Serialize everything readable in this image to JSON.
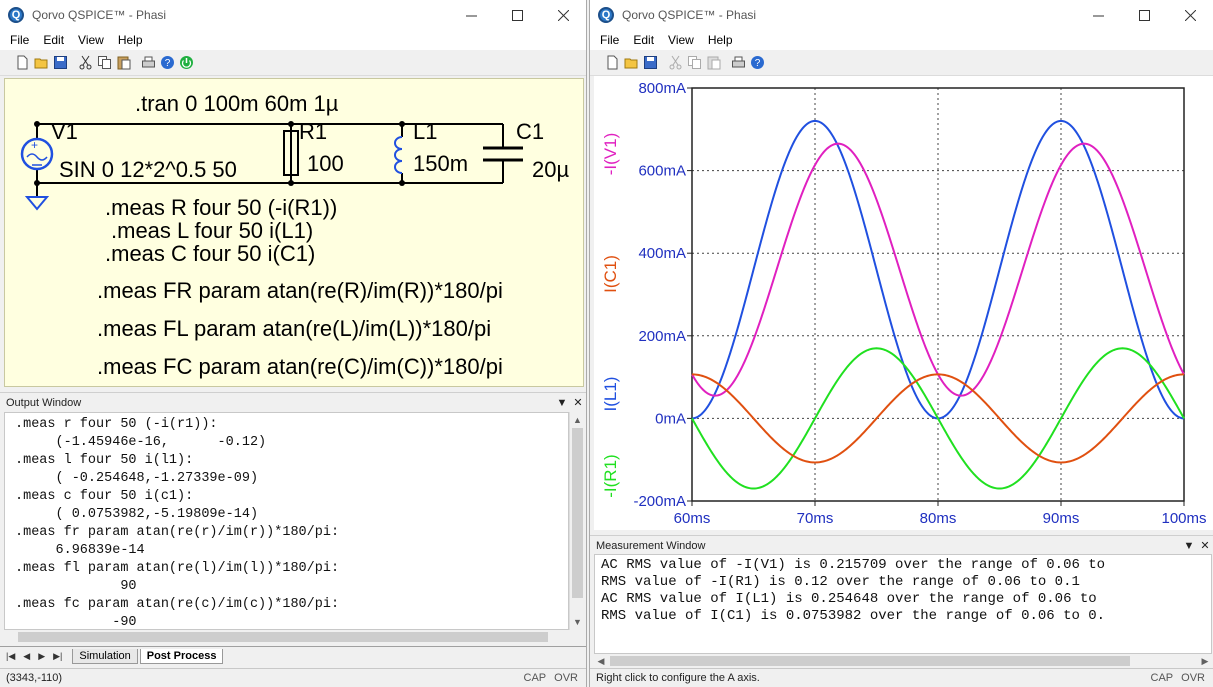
{
  "left_window": {
    "title": "Qorvo QSPICE™ - Phasi",
    "menu": [
      "File",
      "Edit",
      "View",
      "Help"
    ],
    "schematic": {
      "directive_tran": ".tran 0 100m 60m 1µ",
      "v1_name": "V1",
      "v1_value": "SIN 0 12*2^0.5 50",
      "r1_name": "R1",
      "r1_value": "100",
      "l1_name": "L1",
      "l1_value": "150m",
      "c1_name": "C1",
      "c1_value": "20µ",
      "meas_lines": [
        ".meas R four 50 (-i(R1))",
        ".meas L four 50 i(L1)",
        ".meas C four 50 i(C1)",
        ".meas FR param  atan(re(R)/im(R))*180/pi",
        ".meas FL param  atan(re(L)/im(L))*180/pi",
        ".meas FC param  atan(re(C)/im(C))*180/pi"
      ]
    },
    "output_window": {
      "title": "Output Window",
      "lines": [
        ".meas r four 50 (-i(r1)):",
        "     (-1.45946e-16,      -0.12)",
        ".meas l four 50 i(l1):",
        "     ( -0.254648,-1.27339e-09)",
        ".meas c four 50 i(c1):",
        "     ( 0.0753982,-5.19809e-14)",
        ".meas fr param atan(re(r)/im(r))*180/pi:",
        "     6.96839e-14",
        ".meas fl param atan(re(l)/im(l))*180/pi:",
        "             90",
        ".meas fc param atan(re(c)/im(c))*180/pi:",
        "            -90"
      ]
    },
    "tabs": [
      "Simulation",
      "Post Process"
    ],
    "status": {
      "coords": "(3343,-110)",
      "cap": "CAP",
      "ovr": "OVR"
    }
  },
  "right_window": {
    "title": "Qorvo QSPICE™ - Phasi",
    "menu": [
      "File",
      "Edit",
      "View",
      "Help"
    ],
    "measurement_window": {
      "title": "Measurement Window",
      "lines": [
        "AC RMS value of -I(V1) is 0.215709 over the range of 0.06 to",
        "RMS value of -I(R1) is 0.12 over the range of 0.06 to 0.1",
        "AC RMS value of I(L1) is 0.254648 over the range of 0.06 to",
        "RMS value of I(C1) is 0.0753982 over the range of 0.06 to 0."
      ]
    },
    "status": {
      "message": "Right click to configure the A axis.",
      "cap": "CAP",
      "ovr": "OVR"
    }
  },
  "chart_data": {
    "type": "line",
    "xlim": [
      0.06,
      0.1
    ],
    "ylim": [
      -0.2,
      0.8
    ],
    "x_ticks": [
      0.06,
      0.07,
      0.08,
      0.09,
      0.1
    ],
    "x_tick_labels": [
      "60ms",
      "70ms",
      "80ms",
      "90ms",
      "100ms"
    ],
    "y_ticks": [
      -0.2,
      0,
      0.2,
      0.4,
      0.6,
      0.8
    ],
    "y_tick_labels": [
      "-200mA",
      "0mA",
      "200mA",
      "400mA",
      "600mA",
      "800mA"
    ],
    "grid": true,
    "legend_placement": "left-vertical",
    "frequency_hz": 50,
    "series": [
      {
        "name": "-I(V1)",
        "color": "#e020c0",
        "kind": "abs_sum",
        "r_amp": 0.16971,
        "l_amp": 0.36013,
        "c_amp": 0.10663,
        "mean": 0.36013
      },
      {
        "name": "I(C1)",
        "color": "#e05010",
        "kind": "cos",
        "amp": 0.10663,
        "mean": 0
      },
      {
        "name": "I(L1)",
        "color": "#2050e0",
        "kind": "one_minus_cos",
        "amp": 0.36013,
        "mean": 0.36013
      },
      {
        "name": "-I(R1)",
        "color": "#20e020",
        "kind": "sin",
        "amp": 0.16971,
        "mean": 0
      }
    ]
  }
}
